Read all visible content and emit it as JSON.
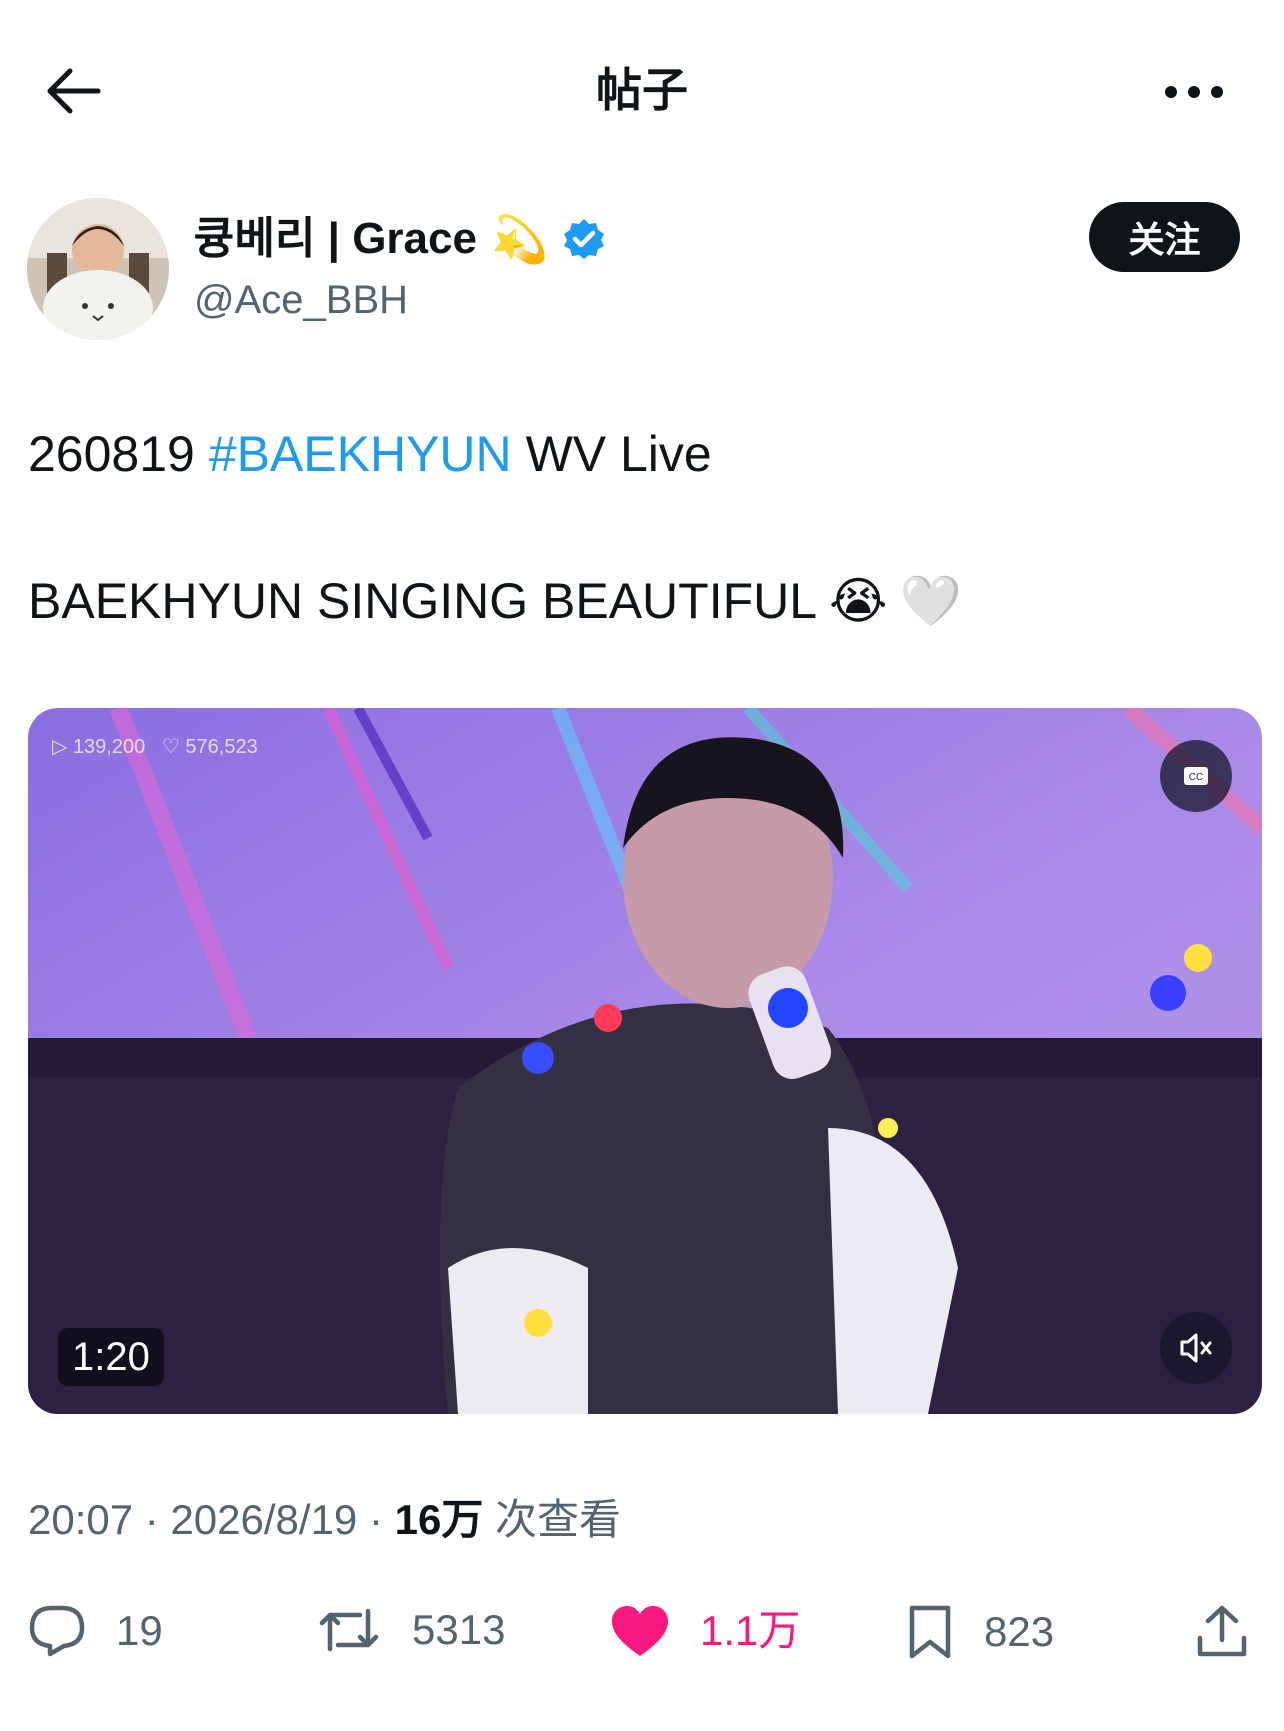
{
  "header": {
    "title": "帖子"
  },
  "author": {
    "display_name": "큥베리 | Grace",
    "name_emoji": "💫",
    "handle": "@Ace_BBH",
    "follow_label": "关注"
  },
  "post": {
    "date_prefix": "260819",
    "hashtag": "#BAEKHYUN",
    "after_tag": "WV Live",
    "line2": "BAEKHYUN SINGING BEAUTIFUL",
    "emoji_cry": "😭",
    "emoji_heart": "🤍"
  },
  "media": {
    "duration": "1:20",
    "overlay_views": "▷ 139,200",
    "overlay_likes": "♡ 576,523",
    "cc_label": "CC"
  },
  "meta": {
    "time": "20:07",
    "separator": " · ",
    "date": "2026/8/19",
    "views_count": "16万",
    "views_label": " 次查看"
  },
  "actions": {
    "replies": "19",
    "reposts": "5313",
    "likes": "1.1万",
    "bookmarks": "823"
  },
  "colors": {
    "accent": "#1d9bf0",
    "like": "#f91880",
    "text": "#0f1419",
    "muted": "#536471"
  }
}
